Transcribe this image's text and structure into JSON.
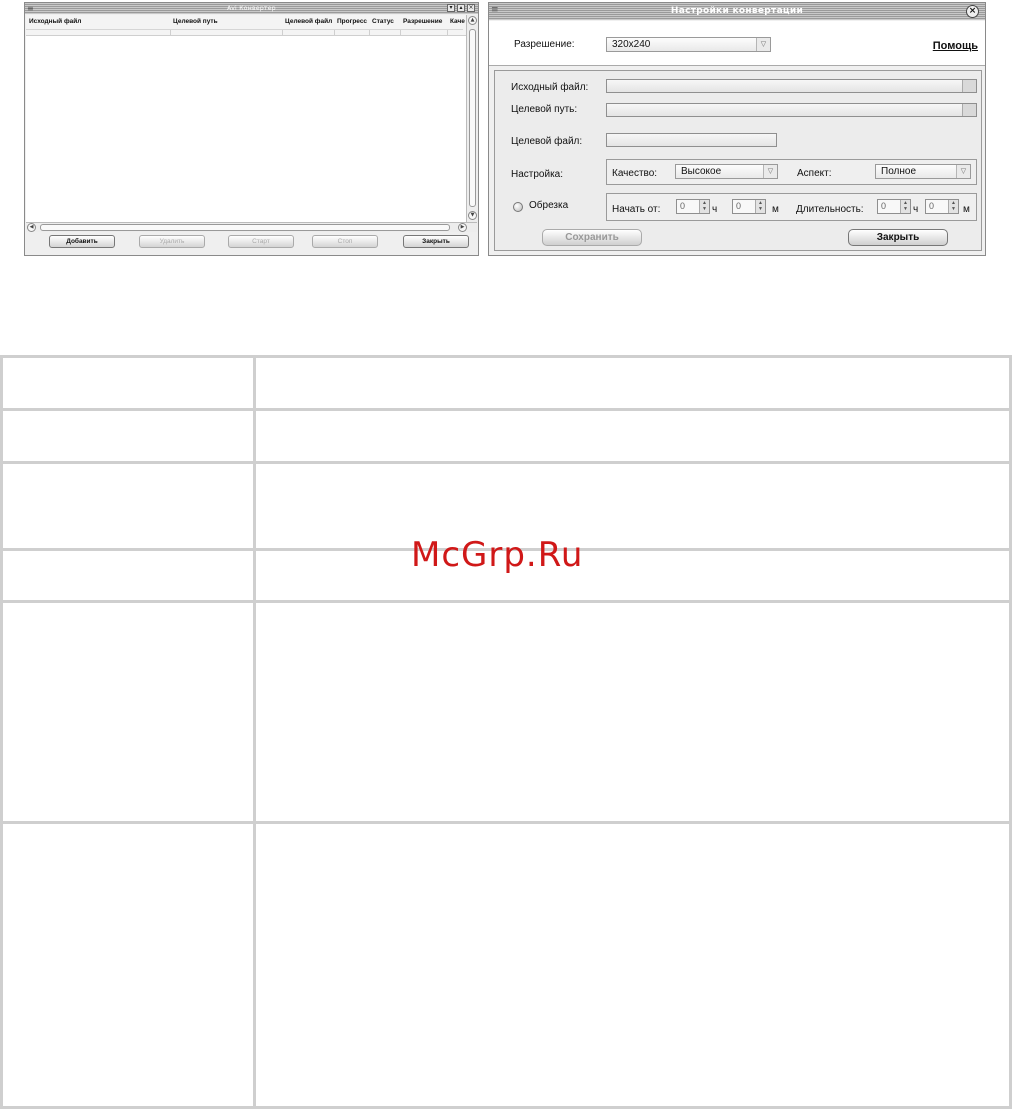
{
  "converter_window": {
    "title": "Avi Конвертер",
    "columns": [
      "Исходный файл",
      "Целевой путь",
      "Целевой файл",
      "Прогресс",
      "Статус",
      "Разрешение",
      "Каче"
    ],
    "buttons": {
      "add": "Добавить",
      "delete": "Удалить",
      "start": "Старт",
      "stop": "Стоп",
      "close": "Закрыть"
    }
  },
  "settings_window": {
    "title": "Настройки конвертации",
    "resolution_label": "Разрешение:",
    "resolution_value": "320x240",
    "help_link": "Помощь",
    "source_label": "Исходный файл:",
    "target_path_label": "Целевой путь:",
    "target_file_label": "Целевой файл:",
    "setting_label": "Настройка:",
    "quality_label": "Качество:",
    "quality_value": "Высокое",
    "aspect_label": "Аспект:",
    "aspect_value": "Полное",
    "trim_label": "Обрезка",
    "start_from_label": "Начать от:",
    "start_hours": "0",
    "hours_unit": "ч",
    "start_minutes": "0",
    "minutes_unit": "м",
    "duration_label": "Длительность:",
    "duration_hours": "0",
    "duration_minutes": "0",
    "save_button": "Сохранить",
    "close_button": "Закрыть"
  },
  "watermark": "McGrp.Ru"
}
